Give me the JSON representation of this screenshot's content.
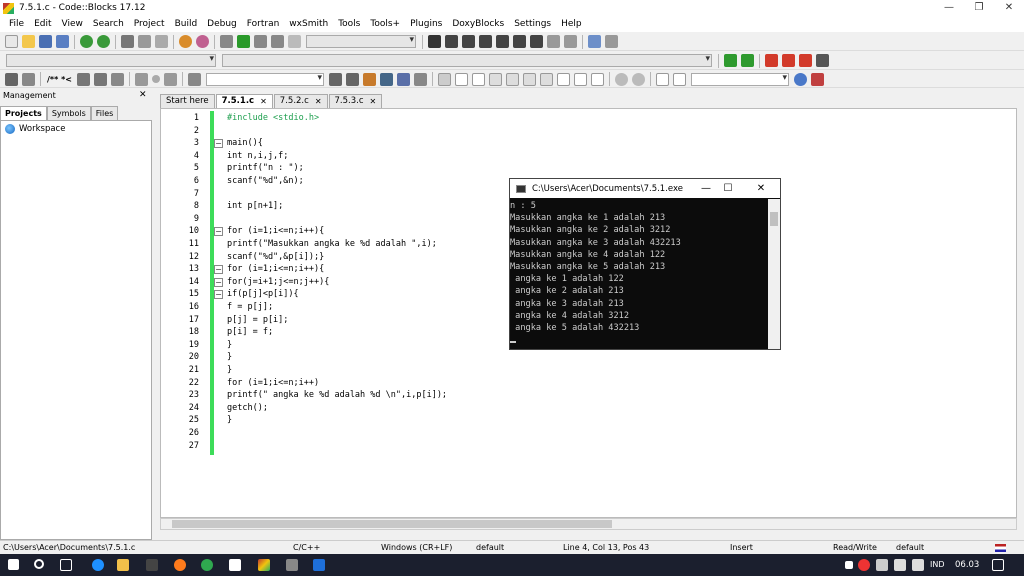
{
  "window": {
    "title": "7.5.1.c - Code::Blocks 17.12",
    "min": "—",
    "max": "❐",
    "close": "✕"
  },
  "menu": [
    "File",
    "Edit",
    "View",
    "Search",
    "Project",
    "Build",
    "Debug",
    "Fortran",
    "wxSmith",
    "Tools",
    "Tools+",
    "Plugins",
    "DoxyBlocks",
    "Settings",
    "Help"
  ],
  "toolbar3": {
    "comment_label": "/** *<"
  },
  "management": {
    "title": "Management",
    "close": "✕",
    "tabs": [
      "Projects",
      "Symbols",
      "Files"
    ],
    "workspace": "Workspace"
  },
  "editor_tabs": [
    {
      "label": "Start here",
      "closable": false
    },
    {
      "label": "7.5.1.c",
      "closable": true
    },
    {
      "label": "7.5.2.c",
      "closable": true
    },
    {
      "label": "7.5.3.c",
      "closable": true
    }
  ],
  "code_lines": [
    "#include <stdio.h>",
    "",
    "main(){",
    "int n,i,j,f;",
    "printf(\"n : \");",
    "scanf(\"%d\",&n);",
    "",
    "int p[n+1];",
    "",
    "for (i=1;i<=n;i++){",
    "printf(\"Masukkan angka ke %d adalah \",i);",
    "scanf(\"%d\",&p[i]);}",
    "for (i=1;i<=n;i++){",
    "for(j=i+1;j<=n;j++){",
    "if(p[j]<p[i]){",
    "f = p[j];",
    "p[j] = p[i];",
    "p[i] = f;",
    "}",
    "}",
    "}",
    "for (i=1;i<=n;i++)",
    "printf(\" angka ke %d adalah %d \\n\",i,p[i]);",
    "getch();",
    "}",
    "",
    ""
  ],
  "line_numbers": [
    "1",
    "2",
    "3",
    "4",
    "5",
    "6",
    "7",
    "8",
    "9",
    "10",
    "11",
    "12",
    "13",
    "14",
    "15",
    "16",
    "17",
    "18",
    "19",
    "20",
    "21",
    "22",
    "23",
    "24",
    "25",
    "26",
    "27"
  ],
  "console": {
    "title": "C:\\Users\\Acer\\Documents\\7.5.1.exe",
    "output": "n : 5\nMasukkan angka ke 1 adalah 213\nMasukkan angka ke 2 adalah 3212\nMasukkan angka ke 3 adalah 432213\nMasukkan angka ke 4 adalah 122\nMasukkan angka ke 5 adalah 213\n angka ke 1 adalah 122\n angka ke 2 adalah 213\n angka ke 3 adalah 213\n angka ke 4 adalah 3212\n angka ke 5 adalah 432213"
  },
  "status": {
    "path": "C:\\Users\\Acer\\Documents\\7.5.1.c",
    "lang": "C/C++",
    "eol": "Windows (CR+LF)",
    "encoding": "default",
    "position": "Line 4, Col 13, Pos 43",
    "mode": "Insert",
    "access": "Read/Write",
    "profile": "default"
  },
  "taskbar": {
    "lang": "IND",
    "time": "06.03"
  }
}
